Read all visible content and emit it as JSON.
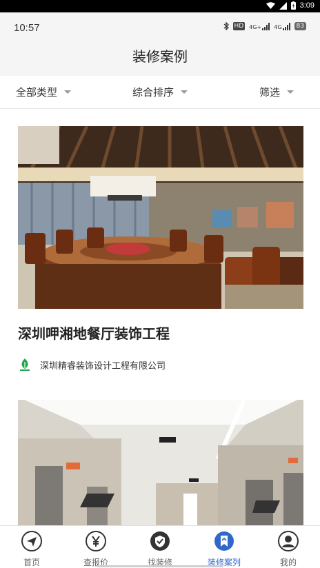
{
  "system_bar": {
    "time": "3:09"
  },
  "status_bar": {
    "clock": "10:57",
    "hd": "HD",
    "net1": "4G+",
    "net2": "4G",
    "battery": "83"
  },
  "header": {
    "title": "装修案例"
  },
  "filters": [
    {
      "label": "全部类型"
    },
    {
      "label": "综合排序"
    },
    {
      "label": "筛选"
    }
  ],
  "cases": [
    {
      "title": "深圳呷湘地餐厅装饰工程",
      "company": "深圳精睿装饰设计工程有限公司"
    },
    {
      "title": "",
      "company": ""
    }
  ],
  "tabs": [
    {
      "label": "首页",
      "icon": "paper-plane-icon"
    },
    {
      "label": "查报价",
      "icon": "yen-icon"
    },
    {
      "label": "找装修",
      "icon": "shield-check-icon"
    },
    {
      "label": "装修案列",
      "icon": "bookmark-icon",
      "active": true
    },
    {
      "label": "我的",
      "icon": "user-icon"
    }
  ],
  "colors": {
    "accent": "#2f68c9",
    "tab_icon": "#333333"
  }
}
